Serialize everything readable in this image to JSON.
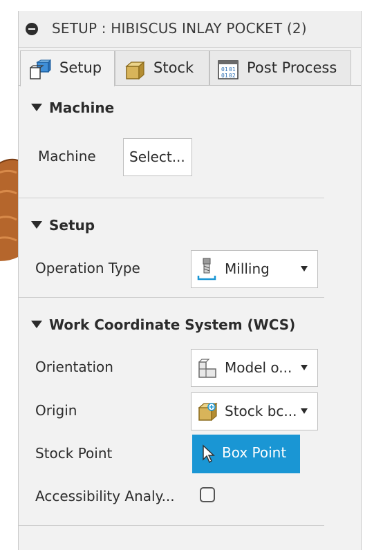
{
  "panel": {
    "title": "SETUP : HIBISCUS INLAY POCKET (2)"
  },
  "tabs": [
    {
      "label": "Setup",
      "icon": "setup-cube-icon",
      "active": true
    },
    {
      "label": "Stock",
      "icon": "stock-box-icon",
      "active": false
    },
    {
      "label": "Post Process",
      "icon": "post-process-icon",
      "active": false
    }
  ],
  "machine_section": {
    "heading": "Machine",
    "machine_label": "Machine",
    "machine_button": "Select..."
  },
  "setup_section": {
    "heading": "Setup",
    "operation_type_label": "Operation Type",
    "operation_type_value": "Milling",
    "operation_icon": "milling-tool-icon"
  },
  "wcs_section": {
    "heading": "Work Coordinate System (WCS)",
    "orientation_label": "Orientation",
    "orientation_value": "Model o...",
    "origin_label": "Origin",
    "origin_value": "Stock bc...",
    "stock_point_label": "Stock Point",
    "stock_point_button": "Box Point",
    "accessibility_label": "Accessibility Analy...",
    "accessibility_checked": false
  },
  "colors": {
    "accent": "#1a96d4",
    "panel_bg": "#f2f2f2"
  }
}
